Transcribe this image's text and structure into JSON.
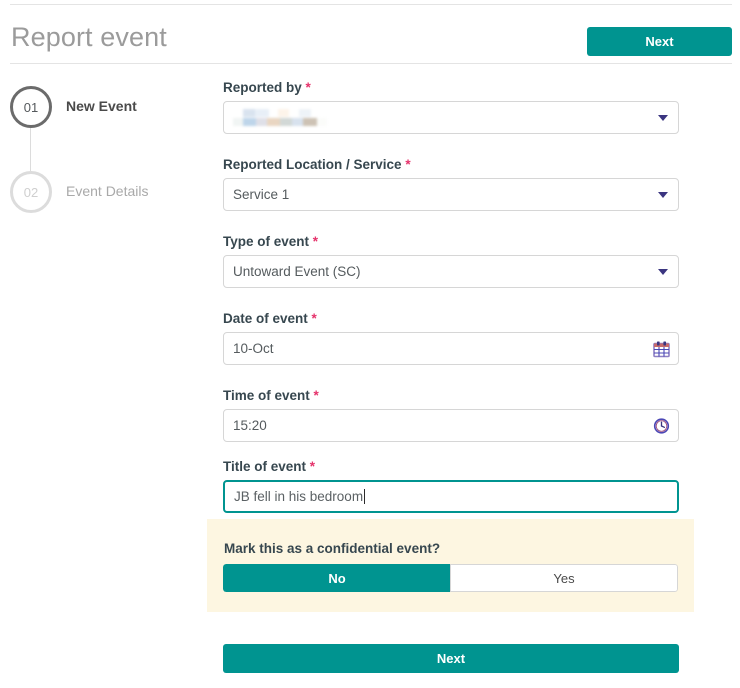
{
  "header": {
    "title": "Report event",
    "next_label": "Next"
  },
  "stepper": {
    "steps": [
      {
        "number": "01",
        "label": "New Event",
        "state": "active"
      },
      {
        "number": "02",
        "label": "Event Details",
        "state": "inactive"
      }
    ]
  },
  "form": {
    "required_marker": "*",
    "fields": [
      {
        "label": "Reported by",
        "required": true,
        "type": "select",
        "value": "",
        "redacted": true,
        "icon": "chevron-down-icon"
      },
      {
        "label": "Reported Location / Service",
        "required": true,
        "type": "select",
        "value": "Service 1",
        "icon": "chevron-down-icon"
      },
      {
        "label": "Type of event",
        "required": true,
        "type": "select",
        "value": "Untoward Event (SC)",
        "icon": "chevron-down-icon"
      },
      {
        "label": "Date of event",
        "required": true,
        "type": "date",
        "value": "10-Oct",
        "icon": "calendar-icon"
      },
      {
        "label": "Time of event",
        "required": true,
        "type": "time",
        "value": "15:20",
        "icon": "clock-icon"
      },
      {
        "label": "Title of event",
        "required": true,
        "type": "text",
        "value": "JB fell in his bedroom",
        "focused": true,
        "icon": ""
      }
    ]
  },
  "confidential": {
    "question": "Mark this as a confidential event?",
    "options": [
      {
        "label": "No",
        "selected": true
      },
      {
        "label": "Yes",
        "selected": false
      }
    ]
  },
  "footer": {
    "next_label": "Next"
  },
  "colors": {
    "accent_teal": "#009490",
    "required_pink": "#e5326b",
    "panel_cream": "#fdf6e1",
    "icon_purple": "#3b3580",
    "step_active": "#6b6b6b",
    "step_inactive": "#dcdcdc"
  }
}
